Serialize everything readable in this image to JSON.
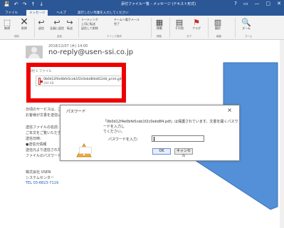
{
  "titlebar": {
    "title": "添付ファイル一覧 - メッセージ (テキスト形式)",
    "quick_access": [
      "💾",
      "↶",
      "↷",
      "↑",
      "↓"
    ],
    "window_buttons": [
      "?",
      "▭",
      "—",
      "▢",
      "✕"
    ]
  },
  "tabs": [
    "ファイル",
    "メッセージ",
    "ヘルプ",
    "実行したい作業を入力してください"
  ],
  "ribbon": {
    "buttons": [
      {
        "icon": "⬚",
        "label": "無視"
      },
      {
        "icon": "✕",
        "label": "削除"
      },
      {
        "icon": "↩",
        "label": "返信"
      },
      {
        "icon": "↩",
        "label": "全員に返信"
      },
      {
        "icon": "↪",
        "label": "転送"
      },
      {
        "icon": "▤",
        "label": "その他"
      },
      {
        "icon": "▦",
        "label": "移動"
      },
      {
        "icon": "⚑",
        "label": "フラグ"
      },
      {
        "icon": "▥",
        "label": "翻訳"
      },
      {
        "icon": "🔍",
        "label": "ズーム"
      }
    ],
    "groups": [
      "削除",
      "返信",
      "クイック操作",
      "移動",
      "タグ",
      "編集",
      "ズーム"
    ],
    "quick_steps": [
      "ミーティング",
      "上司に転送",
      "返信して削除",
      "チームへ電子メール",
      "完了"
    ]
  },
  "message": {
    "date": "2018/12/07 (木) 14:00",
    "sender": "no-reply@usen-ssi.co.jp",
    "attach_label": "添付 1 ファイル",
    "attachment_name": "0b0d12f4e0bfe5ceb1f2c0ebd84e812dd_print.pdf",
    "attachment_size": "264 KB",
    "body": [
      "日頃のサービスは、ご利用の皆様に",
      "お客様が文書を送信いたしました",
      "",
      "送信ファイルの名前",
      "ご本文をご覧いただきますようお願いいたします",
      "送信日時：",
      "●送信元情報",
      "送信元より送信された文書",
      "ファイルのパスワードは別途送信したもので開いてください",
      "",
      "株式会社 USEN",
      "システムセンター",
      "TEL 03-6823-7119"
    ]
  },
  "dialog": {
    "title": "パスワード",
    "message_line1": "「0b0d12f4e0bfe5ceb1f2c0ebd84.pdf」は保護されています。文書を開くパスワードを入力し",
    "message_line2": "てください。",
    "password_label": "パスワードを入力：",
    "password_value": "",
    "ok_label": "OK",
    "cancel_label": "キャンセル"
  },
  "colors": {
    "titlebar": "#2b5797",
    "highlight": "#ee0000",
    "callout": "#4a8bd6",
    "warning": "#f0a83b"
  }
}
